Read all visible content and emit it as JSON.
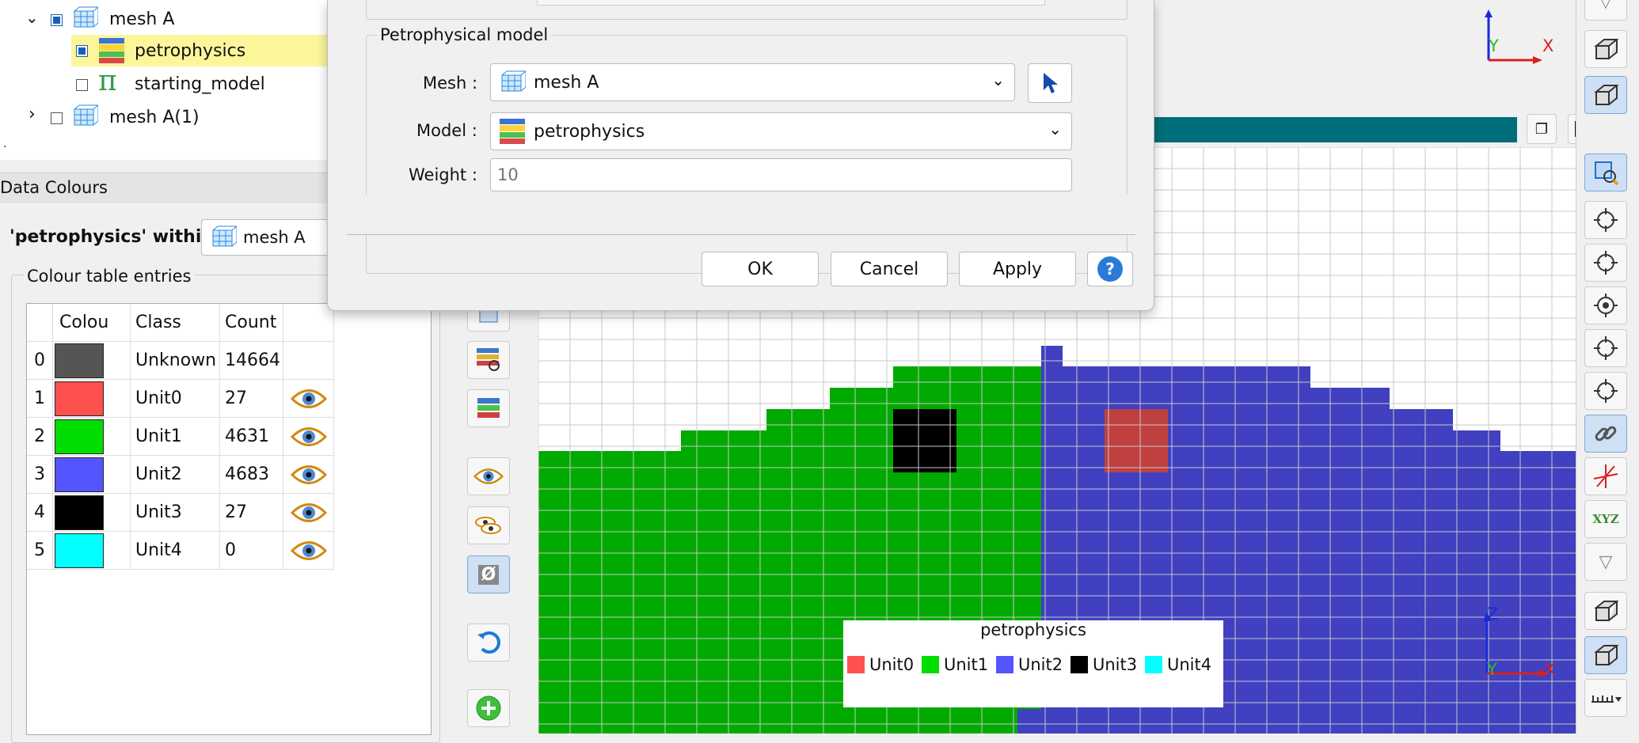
{
  "tree": {
    "items": [
      {
        "label": "mesh A",
        "checked": true
      },
      {
        "label": "petrophysics",
        "checked": true
      },
      {
        "label": "starting_model",
        "checked": false
      },
      {
        "label": "mesh A(1)",
        "checked": false
      }
    ],
    "starting_model_icon": "π"
  },
  "data_colours": {
    "panel_title": "Data Colours",
    "within_label": "'petrophysics' within",
    "mesh_label": "mesh A",
    "group_title": "Colour table entries",
    "columns": [
      "Colou",
      "Class",
      "Count"
    ],
    "rows": [
      {
        "index": "0",
        "color": "#555555",
        "class": "Unknown",
        "count": "14664",
        "eye": false
      },
      {
        "index": "1",
        "color": "#ff5050",
        "class": "Unit0",
        "count": "27",
        "eye": true
      },
      {
        "index": "2",
        "color": "#00dd00",
        "class": "Unit1",
        "count": "4631",
        "eye": true
      },
      {
        "index": "3",
        "color": "#5555ff",
        "class": "Unit2",
        "count": "4683",
        "eye": true
      },
      {
        "index": "4",
        "color": "#000000",
        "class": "Unit3",
        "count": "27",
        "eye": true
      },
      {
        "index": "5",
        "color": "#00ffff",
        "class": "Unit4",
        "count": "0",
        "eye": true
      }
    ]
  },
  "dialog": {
    "group_title": "Petrophysical model",
    "mesh_label": "Mesh :",
    "mesh_value": "mesh A",
    "model_label": "Model :",
    "model_value": "petrophysics",
    "weight_label": "Weight :",
    "weight_placeholder": "10",
    "ok": "OK",
    "cancel": "Cancel",
    "apply": "Apply",
    "help": "?"
  },
  "viewport": {
    "legend_title": "petrophysics",
    "legend_items": [
      {
        "label": "Unit0",
        "color": "#ff5050"
      },
      {
        "label": "Unit1",
        "color": "#00dd00"
      },
      {
        "label": "Unit2",
        "color": "#5555ff"
      },
      {
        "label": "Unit3",
        "color": "#000000"
      },
      {
        "label": "Unit4",
        "color": "#00ffff"
      }
    ],
    "axis_x": "X",
    "axis_y": "Y",
    "axis_z": "Z",
    "colors": {
      "unit1_fill": "#00aa00",
      "unit2_fill": "#4040c0",
      "unit0_fill": "#c04040",
      "teal_bar": "#006e7a"
    }
  },
  "right_toolbar": {
    "xyz_label": "XYZ"
  }
}
